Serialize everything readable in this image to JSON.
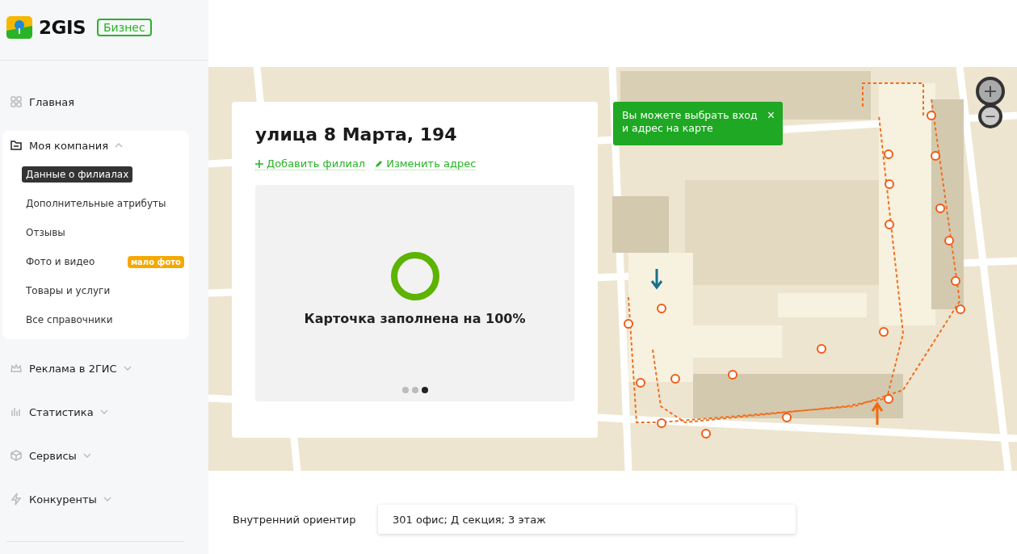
{
  "logo": {
    "text": "2GIS",
    "badge": "Бизнес"
  },
  "sidebar": {
    "items": [
      {
        "kind": "link",
        "label": "Главная"
      },
      {
        "kind": "group",
        "label": "Моя компания",
        "expanded": true,
        "children": [
          {
            "label": "Данные о филиалах",
            "selected": true
          },
          {
            "label": "Дополнительные атрибуты",
            "selected": false
          },
          {
            "label": "Отзывы",
            "selected": false
          },
          {
            "label": "Фото и видео",
            "selected": false,
            "badge": "мало фото"
          },
          {
            "label": "Товары и услуги",
            "selected": false
          },
          {
            "label": "Все справочники",
            "selected": false
          }
        ]
      },
      {
        "kind": "group",
        "label": "Реклама в 2ГИС",
        "expanded": false
      },
      {
        "kind": "group",
        "label": "Статистика",
        "expanded": false
      },
      {
        "kind": "group",
        "label": "Сервисы",
        "expanded": false
      },
      {
        "kind": "group",
        "label": "Конкуренты",
        "expanded": false
      }
    ]
  },
  "address_card": {
    "title": "улица 8 Марта, 194",
    "actions": [
      {
        "label": "Добавить филиал"
      },
      {
        "label": "Изменить адрес"
      }
    ],
    "carousel": {
      "text": "Карточка заполнена на 100%",
      "level": 1,
      "dots": [
        {
          "selected": false
        },
        {
          "selected": false
        },
        {
          "selected": true
        }
      ]
    }
  },
  "toast": {
    "text": "Вы можете выбрать вход и адрес на карте",
    "close": "×"
  },
  "zoom_controls": [
    "+",
    "−"
  ],
  "landmark_field": {
    "label": "Внутренний ориентир",
    "value": "301 офис; Д секция; 3 этаж"
  }
}
